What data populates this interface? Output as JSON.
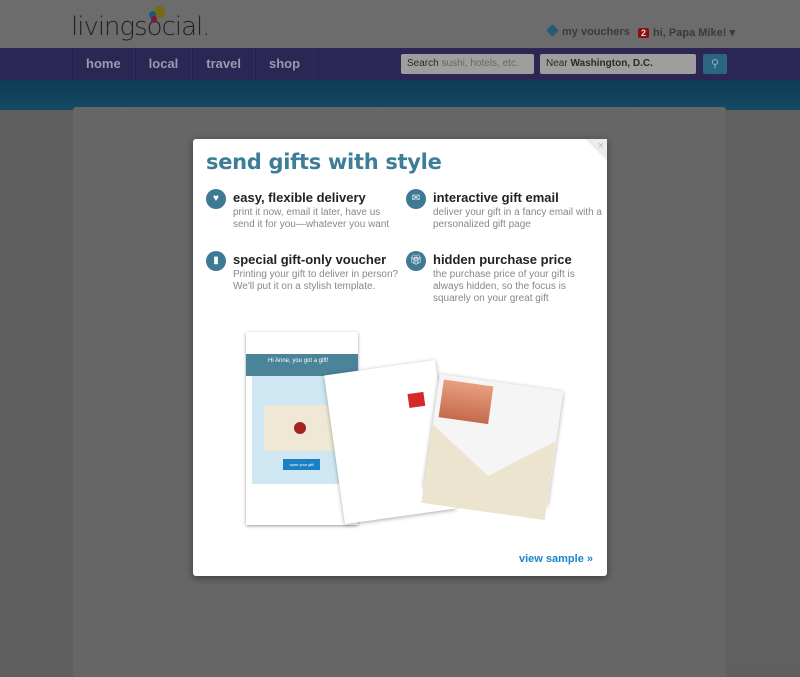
{
  "header": {
    "logo": "livingsocial.",
    "my_vouchers": "my vouchers",
    "notification_count": "2",
    "greeting": "hi, Papa Mike!"
  },
  "nav": {
    "items": [
      "home",
      "local",
      "travel",
      "shop"
    ],
    "search_label": "Search",
    "search_placeholder": "sushi, hotels, etc.",
    "near_label": "Near",
    "near_value": "Washington, D.C."
  },
  "modal": {
    "title": "send gifts with style",
    "close": "×",
    "features": [
      {
        "icon": "heart-icon",
        "title": "easy, flexible delivery",
        "desc": "print it now, email it later, have us send it for you—whatever you want"
      },
      {
        "icon": "envelope-icon",
        "title": "interactive gift email",
        "desc": "deliver your gift in a fancy email with a personalized gift page"
      },
      {
        "icon": "document-icon",
        "title": "special gift-only voucher",
        "desc": "Printing your gift to deliver in person? We'll put it on a stylish template."
      },
      {
        "icon": "gift-icon",
        "title": "hidden purchase price",
        "desc": "the purchase price of your gift is always hidden, so the focus is squarely on your great gift"
      }
    ],
    "illustration": {
      "greeting": "Hi Anne, you got a gift!",
      "button": "open your gift"
    },
    "view_sample": "view sample »"
  },
  "colors": {
    "accent": "#3d7d98",
    "link": "#1a87c9",
    "nav": "#2b2653"
  }
}
